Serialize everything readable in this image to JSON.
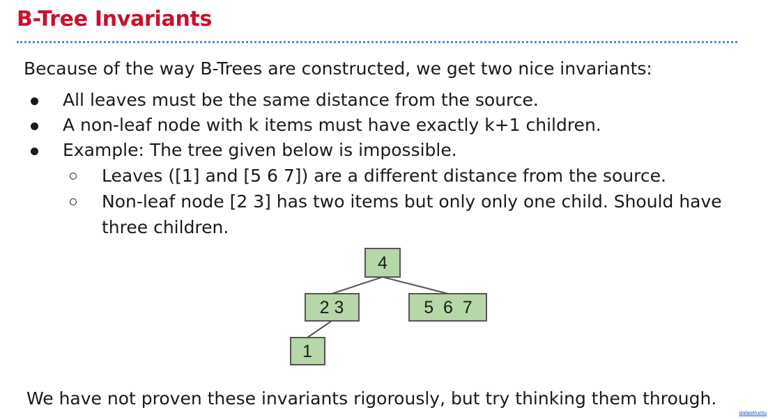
{
  "slide": {
    "title": "B-Tree Invariants",
    "intro": "Because of the way B-Trees are constructed, we get two nice invariants:",
    "bullets": [
      "All leaves must be the same distance from the source.",
      "A non-leaf node with k items must have exactly k+1 children.",
      "Example: The tree given below is impossible."
    ],
    "sub_bullets": [
      "Leaves ([1] and [5 6 7]) are a different distance from the source.",
      "Non-leaf node [2 3] has two items but only only one child. Should have three children."
    ],
    "conclusion": "We have not proven these invariants rigorously, but try thinking them through.",
    "footer_link": "datastructu"
  },
  "tree": {
    "node_fill": "#b6d7a8",
    "node_stroke": "#555555",
    "nodes": [
      {
        "id": "root",
        "label": "4"
      },
      {
        "id": "left",
        "label": "2 3"
      },
      {
        "id": "right",
        "label": "5  6  7"
      },
      {
        "id": "leaf",
        "label": "1"
      }
    ]
  }
}
